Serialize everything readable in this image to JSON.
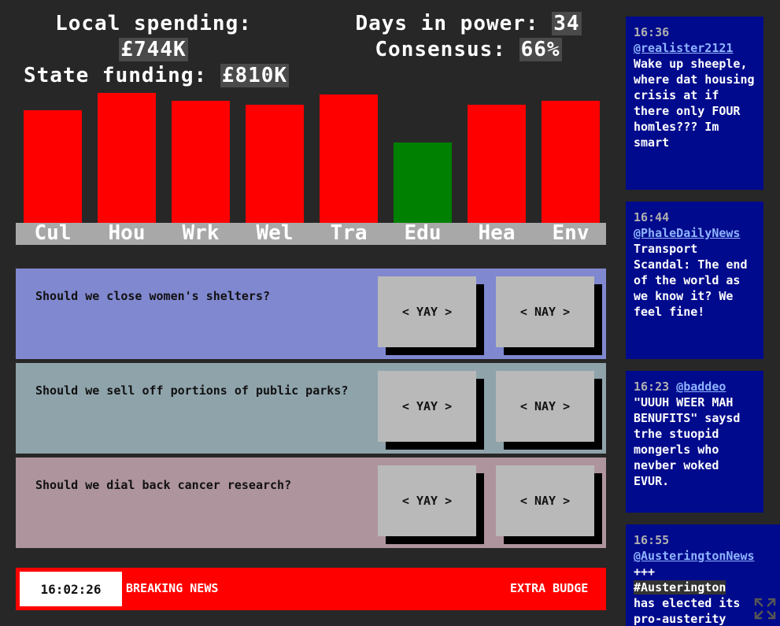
{
  "stats": {
    "local_label": "Local spending:",
    "local_value": "£744K",
    "days_label": "Days in power:",
    "days_value": "34",
    "consensus_label": "Consensus:",
    "consensus_value": "66%",
    "state_label": "State funding:",
    "state_value": "£810K"
  },
  "chart_data": {
    "type": "bar",
    "categories": [
      "Cul",
      "Hou",
      "Wrk",
      "Wel",
      "Tra",
      "Edu",
      "Hea",
      "Env"
    ],
    "values": [
      84,
      97,
      91,
      88,
      96,
      60,
      88,
      91
    ],
    "ylim": [
      0,
      100
    ],
    "colors": [
      "#ff0000",
      "#ff0000",
      "#ff0000",
      "#ff0000",
      "#ff0000",
      "#008000",
      "#ff0000",
      "#ff0000"
    ]
  },
  "policies": [
    {
      "question": "Should we close women's shelters?",
      "yay": "< YAY >",
      "nay": "< NAY >",
      "color": "#8088d0"
    },
    {
      "question": "Should we sell off portions of public parks?",
      "yay": "< YAY >",
      "nay": "< NAY >",
      "color": "#8fa3ab"
    },
    {
      "question": "Should we dial back cancer research?",
      "yay": "< YAY >",
      "nay": "< NAY >",
      "color": "#ae949c"
    }
  ],
  "ticker": {
    "clock": "16:02:26",
    "headline_a": "BREAKING NEWS",
    "headline_b": "EXTRA BUDGE"
  },
  "feed": [
    {
      "time": "16:36",
      "user": "@realister2121",
      "body": "Wake up sheeple, where dat housing crisis at if there only FOUR homles??? Im smart"
    },
    {
      "time": "16:44",
      "user": "@PhaleDailyNews",
      "body": "Transport Scandal: The end of the world as we know it? We feel fine!"
    },
    {
      "time": "16:23",
      "user": "@baddeo",
      "body": "\"UUUH WEER MAH BENUFITS\" saysd trhe stuopid mongerls who nevber woked EVUR."
    },
    {
      "time": "16:55",
      "user": "@AusteringtonNews",
      "body_prefix": "+++",
      "hashtag": "#Austerington",
      "body": "has elected its pro-austerity"
    }
  ],
  "icons": {
    "expand": "expand-icon"
  },
  "colors": {
    "bar_red": "#ff0000",
    "bar_green": "#008000",
    "feed_bg": "#000a8c",
    "page_bg": "#272727"
  }
}
